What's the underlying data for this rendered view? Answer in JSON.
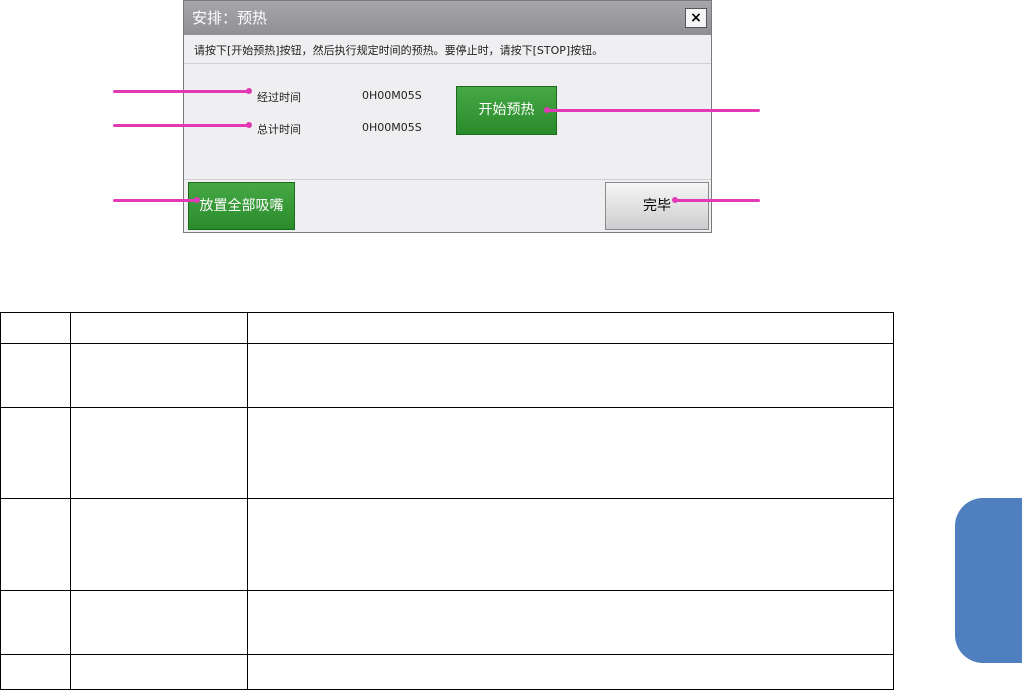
{
  "dialog": {
    "title": "安排：预热",
    "close_label": "×",
    "instruction": "请按下[开始预热]按钮，然后执行规定时间的预热。要停止时，请按下[STOP]按钮。",
    "elapsed_label": "经过时间",
    "elapsed_value": "0H00M05S",
    "total_label": "总计时间",
    "total_value": "0H00M05S",
    "start_button": "开始预热",
    "place_all_button": "放置全部吸嘴",
    "done_button": "完毕"
  },
  "colors": {
    "callout": "#e23ab7",
    "green_button": "#2f942f",
    "side_tab": "#4f7fbe"
  }
}
